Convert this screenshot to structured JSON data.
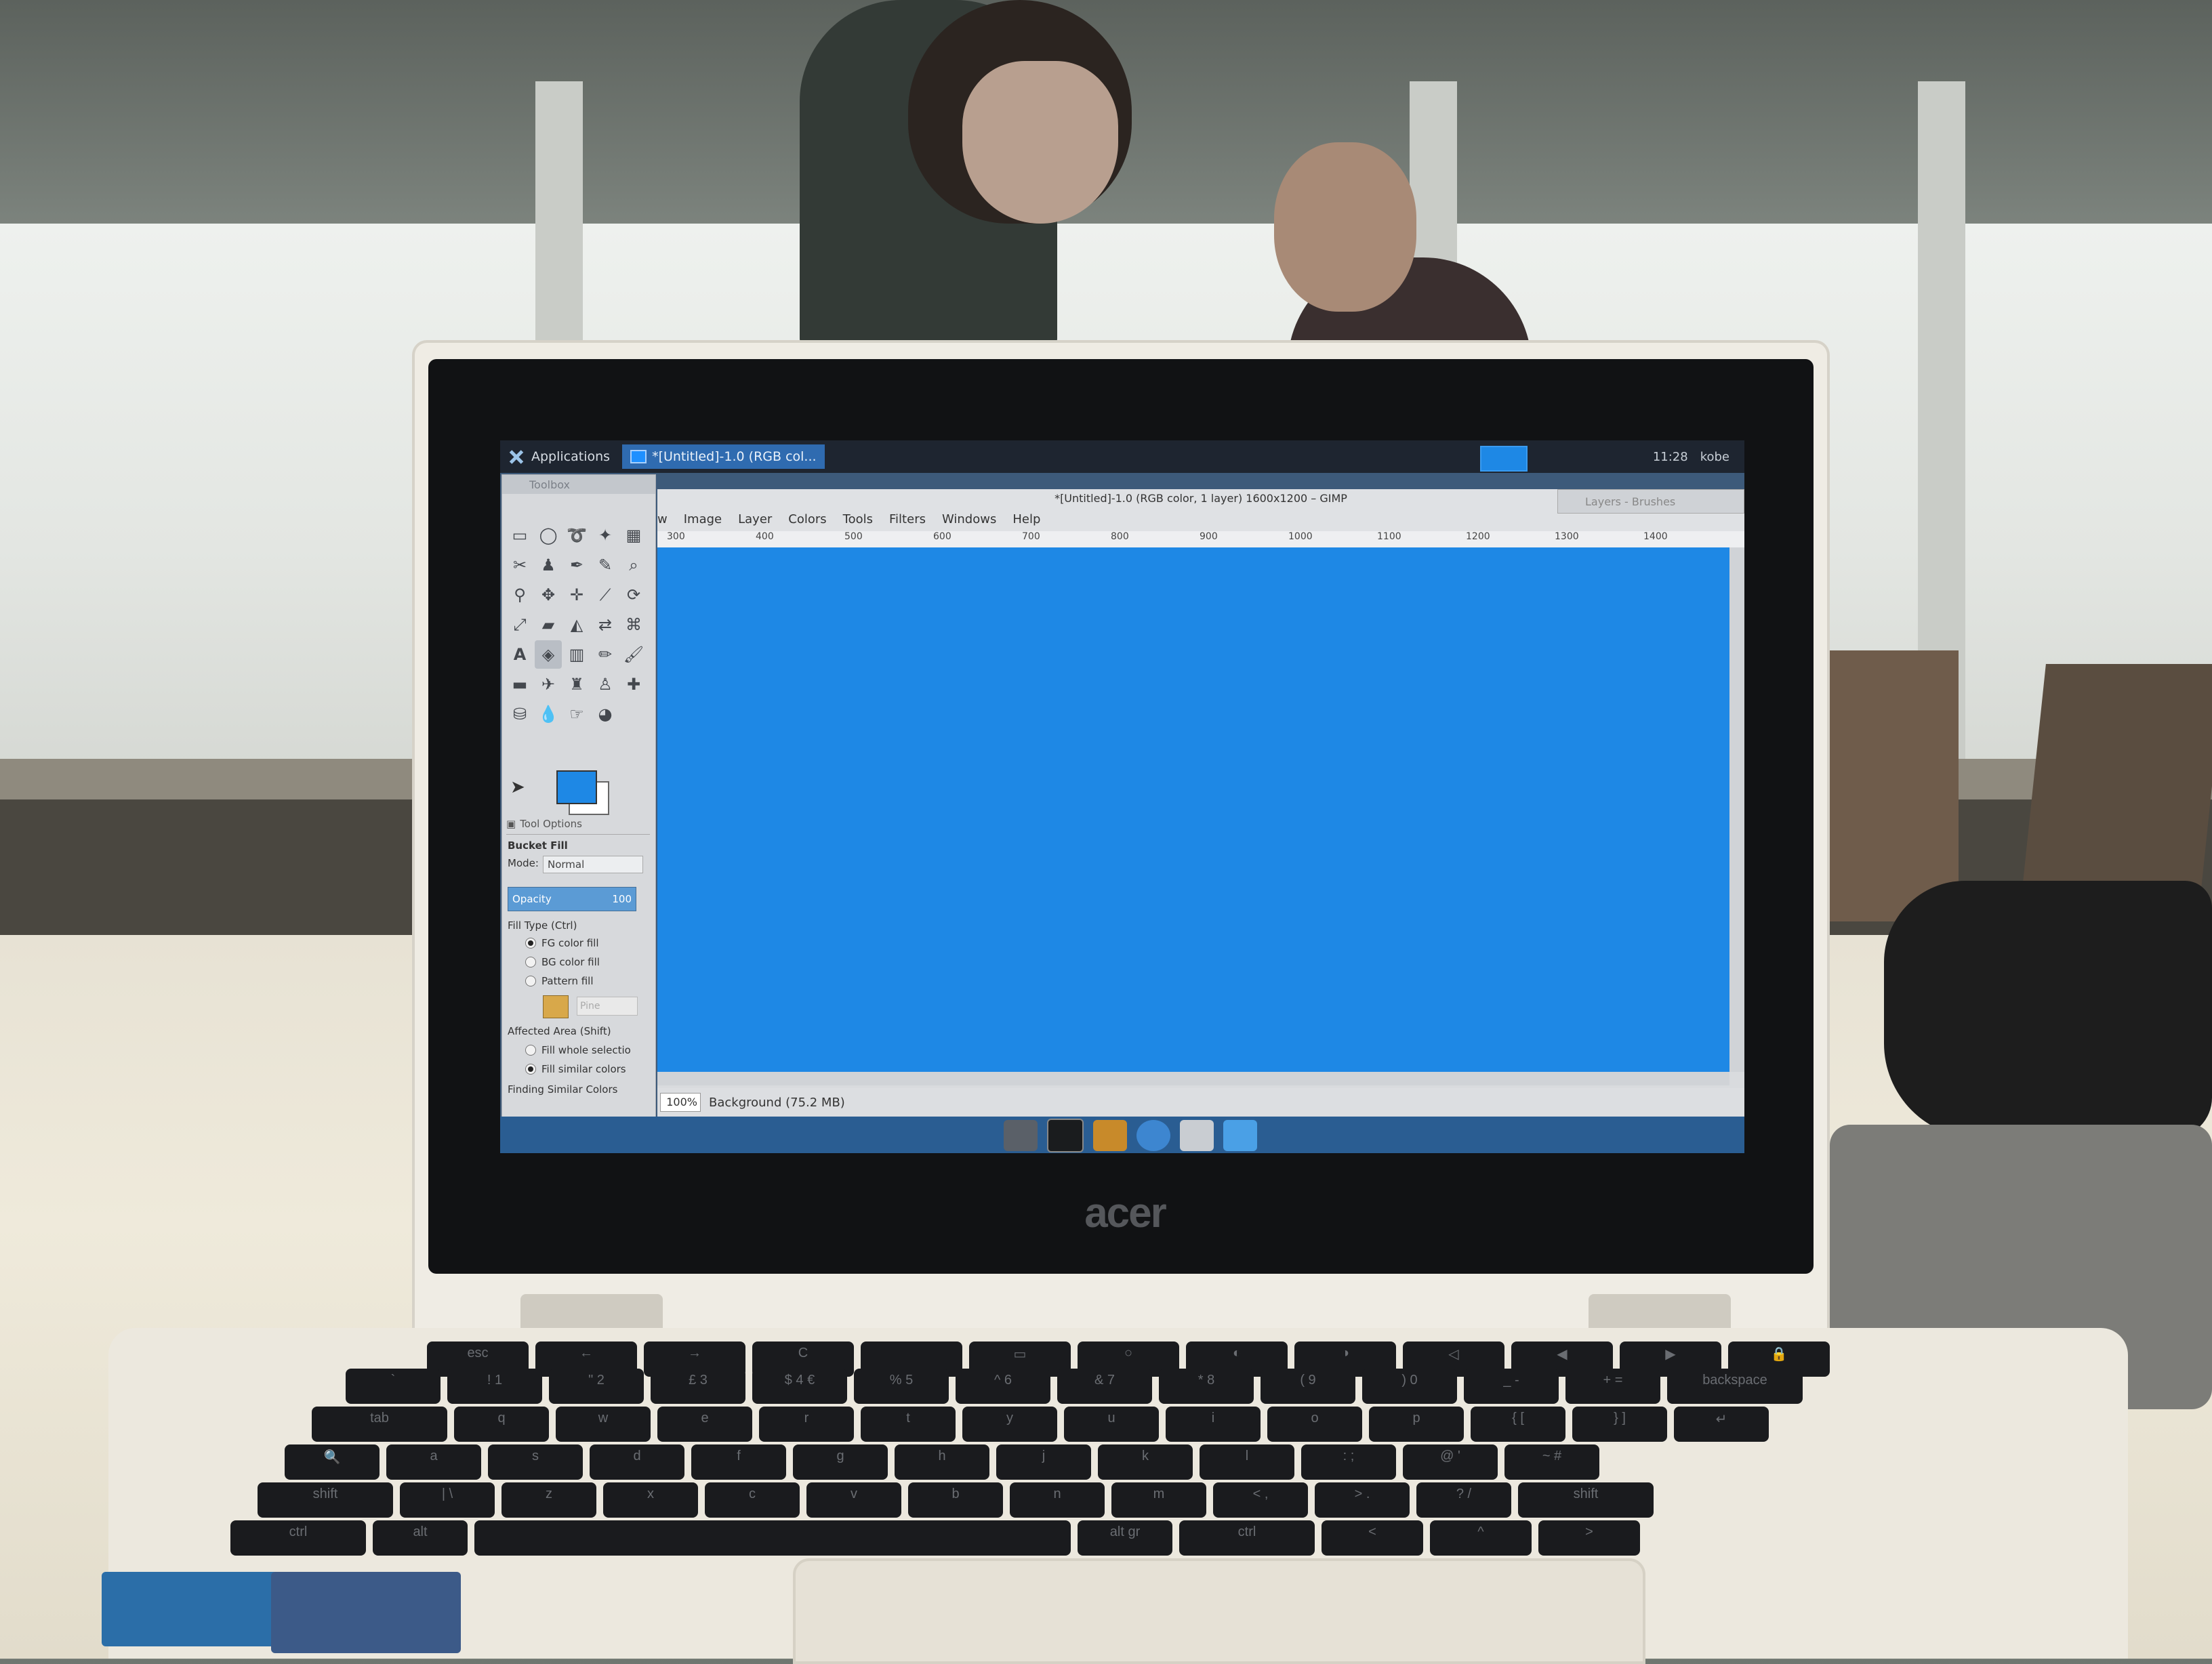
{
  "topbar": {
    "applications_label": "Applications",
    "task_label": "*[Untitled]-1.0 (RGB col...",
    "clock": "11:28",
    "user": "kobe"
  },
  "toolbox": {
    "title": "Toolbox",
    "tool_options_tab": "Tool Options",
    "tool_name": "Bucket Fill",
    "mode_label": "Mode:",
    "mode_value": "Normal",
    "opacity_label": "Opacity",
    "opacity_value": "100",
    "fill_type_label": "Fill Type  (Ctrl)",
    "fill_options": [
      "FG color fill",
      "BG color fill",
      "Pattern fill"
    ],
    "pattern_name": "Pine",
    "affected_area_label": "Affected Area  (Shift)",
    "affected_options": [
      "Fill whole selectio",
      "Fill similar colors"
    ],
    "finding_label": "Finding Similar Colors",
    "fg_color": "#1e88e5",
    "bg_color": "#ffffff"
  },
  "image_window": {
    "title": "*[Untitled]-1.0 (RGB color, 1 layer) 1600x1200 – GIMP",
    "menus": [
      "w",
      "Image",
      "Layer",
      "Colors",
      "Tools",
      "Filters",
      "Windows",
      "Help"
    ],
    "ruler_marks": [
      "300",
      "400",
      "500",
      "600",
      "700",
      "800",
      "900",
      "1000",
      "1100",
      "1200",
      "1300",
      "1400"
    ],
    "zoom": "100%",
    "status": "Background (75.2 MB)",
    "canvas_color": "#1e88e5"
  },
  "layers_window": {
    "title": "Layers - Brushes"
  },
  "laptop": {
    "brand": "acer"
  },
  "keyboard": {
    "row1": [
      "esc",
      "←",
      "→",
      "C",
      "",
      "▭",
      "○",
      "◐",
      "◑",
      "◁",
      "◀",
      "▶",
      "🔒"
    ],
    "row2": [
      "`",
      "! 1",
      "\" 2",
      "£ 3",
      "$ 4 €",
      "% 5",
      "^ 6",
      "& 7",
      "* 8",
      "( 9",
      ") 0",
      "_ -",
      "+ =",
      "backspace"
    ],
    "row3": [
      "tab",
      "q",
      "w",
      "e",
      "r",
      "t",
      "y",
      "u",
      "i",
      "o",
      "p",
      "{ [",
      "} ]",
      "↵"
    ],
    "row4": [
      "🔍",
      "a",
      "s",
      "d",
      "f",
      "g",
      "h",
      "j",
      "k",
      "l",
      ": ;",
      "@ '",
      "~ #"
    ],
    "row5": [
      "shift",
      "| \\",
      "z",
      "x",
      "c",
      "v",
      "b",
      "n",
      "m",
      "< ,",
      "> .",
      "? /",
      "shift"
    ],
    "row6": [
      "ctrl",
      "alt",
      "",
      "alt gr",
      "ctrl",
      "<",
      "^",
      ">"
    ]
  }
}
